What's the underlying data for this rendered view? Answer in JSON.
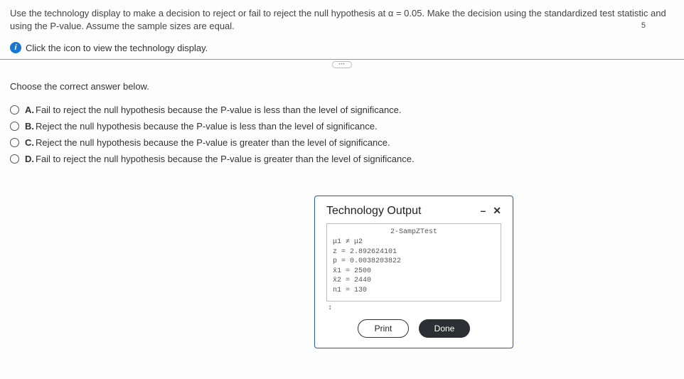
{
  "top": {
    "prompt": "Use the technology display to make a decision to reject or fail to reject the null hypothesis at α = 0.05. Make the decision using the standardized test statistic and using the P-value. Assume the sample sizes are equal.",
    "link_label": "Click the icon to view the technology display.",
    "corner_num": "5"
  },
  "divider_glyph": "•••",
  "question": {
    "instruction": "Choose the correct answer below.",
    "options": [
      {
        "letter": "A.",
        "text": "Fail to reject the null hypothesis because the P-value is less than the level of significance."
      },
      {
        "letter": "B.",
        "text": "Reject the null hypothesis because the P-value is less than the level of significance."
      },
      {
        "letter": "C.",
        "text": "Reject the null hypothesis because the P-value is greater than the level of significance."
      },
      {
        "letter": "D.",
        "text": "Fail to reject the null hypothesis because the P-value is greater than the level of significance."
      }
    ]
  },
  "dialog": {
    "title": "Technology Output",
    "minimize": "–",
    "close": "✕",
    "output": {
      "heading": "2-SampZTest",
      "lines": [
        "μ1 ≠ μ2",
        "z = 2.892624101",
        "p = 0.0038203822",
        "x̄1 = 2500",
        "x̄2 = 2440",
        "n1 = 130"
      ]
    },
    "foot_glyph": "↕",
    "print": "Print",
    "done": "Done"
  }
}
